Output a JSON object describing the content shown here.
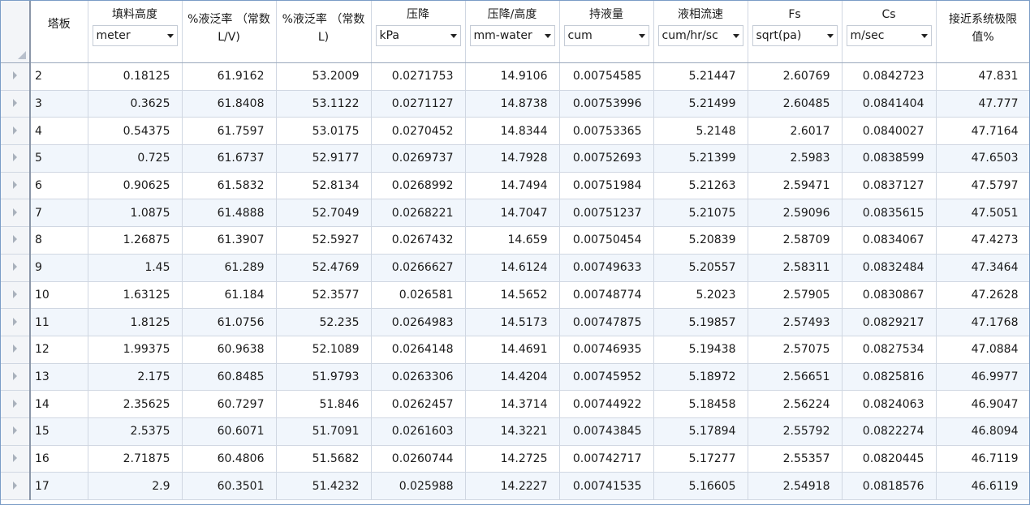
{
  "columns": [
    {
      "label": "塔板",
      "unit": null
    },
    {
      "label": "填料高度",
      "unit": "meter"
    },
    {
      "label": "%液泛率 （常数L/V)",
      "unit": null
    },
    {
      "label": "%液泛率 （常数L)",
      "unit": null
    },
    {
      "label": "压降",
      "unit": "kPa"
    },
    {
      "label": "压降/高度",
      "unit": "mm-water"
    },
    {
      "label": "持液量",
      "unit": "cum"
    },
    {
      "label": "液相流速",
      "unit": "cum/hr/sc"
    },
    {
      "label": "Fs",
      "unit": "sqrt(pa)"
    },
    {
      "label": "Cs",
      "unit": "m/sec"
    },
    {
      "label": "接近系统极限值%",
      "unit": null
    }
  ],
  "rows": [
    [
      "2",
      "0.18125",
      "61.9162",
      "53.2009",
      "0.0271753",
      "14.9106",
      "0.00754585",
      "5.21447",
      "2.60769",
      "0.0842723",
      "47.831"
    ],
    [
      "3",
      "0.3625",
      "61.8408",
      "53.1122",
      "0.0271127",
      "14.8738",
      "0.00753996",
      "5.21499",
      "2.60485",
      "0.0841404",
      "47.777"
    ],
    [
      "4",
      "0.54375",
      "61.7597",
      "53.0175",
      "0.0270452",
      "14.8344",
      "0.00753365",
      "5.2148",
      "2.6017",
      "0.0840027",
      "47.7164"
    ],
    [
      "5",
      "0.725",
      "61.6737",
      "52.9177",
      "0.0269737",
      "14.7928",
      "0.00752693",
      "5.21399",
      "2.5983",
      "0.0838599",
      "47.6503"
    ],
    [
      "6",
      "0.90625",
      "61.5832",
      "52.8134",
      "0.0268992",
      "14.7494",
      "0.00751984",
      "5.21263",
      "2.59471",
      "0.0837127",
      "47.5797"
    ],
    [
      "7",
      "1.0875",
      "61.4888",
      "52.7049",
      "0.0268221",
      "14.7047",
      "0.00751237",
      "5.21075",
      "2.59096",
      "0.0835615",
      "47.5051"
    ],
    [
      "8",
      "1.26875",
      "61.3907",
      "52.5927",
      "0.0267432",
      "14.659",
      "0.00750454",
      "5.20839",
      "2.58709",
      "0.0834067",
      "47.4273"
    ],
    [
      "9",
      "1.45",
      "61.289",
      "52.4769",
      "0.0266627",
      "14.6124",
      "0.00749633",
      "5.20557",
      "2.58311",
      "0.0832484",
      "47.3464"
    ],
    [
      "10",
      "1.63125",
      "61.184",
      "52.3577",
      "0.026581",
      "14.5652",
      "0.00748774",
      "5.2023",
      "2.57905",
      "0.0830867",
      "47.2628"
    ],
    [
      "11",
      "1.8125",
      "61.0756",
      "52.235",
      "0.0264983",
      "14.5173",
      "0.00747875",
      "5.19857",
      "2.57493",
      "0.0829217",
      "47.1768"
    ],
    [
      "12",
      "1.99375",
      "60.9638",
      "52.1089",
      "0.0264148",
      "14.4691",
      "0.00746935",
      "5.19438",
      "2.57075",
      "0.0827534",
      "47.0884"
    ],
    [
      "13",
      "2.175",
      "60.8485",
      "51.9793",
      "0.0263306",
      "14.4204",
      "0.00745952",
      "5.18972",
      "2.56651",
      "0.0825816",
      "46.9977"
    ],
    [
      "14",
      "2.35625",
      "60.7297",
      "51.846",
      "0.0262457",
      "14.3714",
      "0.00744922",
      "5.18458",
      "2.56224",
      "0.0824063",
      "46.9047"
    ],
    [
      "15",
      "2.5375",
      "60.6071",
      "51.7091",
      "0.0261603",
      "14.3221",
      "0.00743845",
      "5.17894",
      "2.55792",
      "0.0822274",
      "46.8094"
    ],
    [
      "16",
      "2.71875",
      "60.4806",
      "51.5682",
      "0.0260744",
      "14.2725",
      "0.00742717",
      "5.17277",
      "2.55357",
      "0.0820445",
      "46.7119"
    ],
    [
      "17",
      "2.9",
      "60.3501",
      "51.4232",
      "0.025988",
      "14.2227",
      "0.00741535",
      "5.16605",
      "2.54918",
      "0.0818576",
      "46.6119"
    ]
  ],
  "icons": {
    "row_selector": "row-arrow-icon",
    "dropdown": "chevron-down-icon",
    "select_all": "select-all-corner-icon"
  },
  "colors": {
    "frame_border": "#7a9cc6",
    "alt_row": "#f1f6fc",
    "grid_line": "#d0d7e2"
  }
}
